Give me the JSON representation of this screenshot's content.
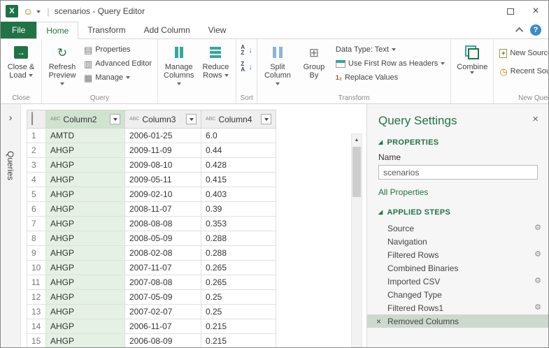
{
  "window": {
    "title": "scenarios - Query Editor",
    "title_separator": "|",
    "excel_logo": "X"
  },
  "icons": {
    "smiley": "☺",
    "close_x": "×",
    "delete_x": "×",
    "gear": "⚙",
    "help": "?",
    "refresh": "↻",
    "sheet": "▤",
    "adv_editor": "▥",
    "manage": "▦",
    "group_by": "⊞",
    "arrow_right": "→",
    "sort_arrow": "↓",
    "replace": "1₂",
    "clock": "◷",
    "plus": "+",
    "triangle": "◢",
    "chevron_right": "›",
    "scroll_up": "▲",
    "type_abc": "ABC"
  },
  "ribbon": {
    "tabs": [
      "File",
      "Home",
      "Transform",
      "Add Column",
      "View"
    ],
    "active_tab": "Home",
    "groups": {
      "close": {
        "label": "Close",
        "close_load": [
          "Close &",
          "Load"
        ]
      },
      "query": {
        "label": "Query",
        "refresh": [
          "Refresh",
          "Preview"
        ],
        "properties": "Properties",
        "advanced_editor": "Advanced Editor",
        "manage": "Manage"
      },
      "columns": {
        "label": "",
        "manage_columns": [
          "Manage",
          "Columns"
        ],
        "reduce_rows": [
          "Reduce",
          "Rows"
        ]
      },
      "sort": {
        "label": "Sort",
        "asc": "AZ",
        "desc": "ZA"
      },
      "transform": {
        "label": "Transform",
        "split_column": [
          "Split",
          "Column"
        ],
        "group_by": [
          "Group",
          "By"
        ],
        "data_type": "Data Type: Text",
        "first_row": "Use First Row as Headers",
        "replace_values": "Replace Values"
      },
      "combine": {
        "label": "",
        "combine": "Combine"
      },
      "new_query": {
        "label": "New Query",
        "new_source": "New Source",
        "recent_sources": "Recent Sources"
      }
    }
  },
  "sidebar": {
    "label": "Queries"
  },
  "grid": {
    "columns": [
      {
        "name": "Column2",
        "type": "ABC",
        "selected": true
      },
      {
        "name": "Column3",
        "type": "ABC",
        "selected": false
      },
      {
        "name": "Column4",
        "type": "ABC",
        "selected": false
      }
    ],
    "rows": [
      {
        "num": 1,
        "cells": [
          "AMTD",
          "2006-01-25",
          "6.0"
        ]
      },
      {
        "num": 2,
        "cells": [
          "AHGP",
          "2009-11-09",
          "0.44"
        ]
      },
      {
        "num": 3,
        "cells": [
          "AHGP",
          "2009-08-10",
          "0.428"
        ]
      },
      {
        "num": 4,
        "cells": [
          "AHGP",
          "2009-05-11",
          "0.415"
        ]
      },
      {
        "num": 5,
        "cells": [
          "AHGP",
          "2009-02-10",
          "0.403"
        ]
      },
      {
        "num": 6,
        "cells": [
          "AHGP",
          "2008-11-07",
          "0.39"
        ]
      },
      {
        "num": 7,
        "cells": [
          "AHGP",
          "2008-08-08",
          "0.353"
        ]
      },
      {
        "num": 8,
        "cells": [
          "AHGP",
          "2008-05-09",
          "0.288"
        ]
      },
      {
        "num": 9,
        "cells": [
          "AHGP",
          "2008-02-08",
          "0.288"
        ]
      },
      {
        "num": 10,
        "cells": [
          "AHGP",
          "2007-11-07",
          "0.265"
        ]
      },
      {
        "num": 11,
        "cells": [
          "AHGP",
          "2007-08-08",
          "0.265"
        ]
      },
      {
        "num": 12,
        "cells": [
          "AHGP",
          "2007-05-09",
          "0.25"
        ]
      },
      {
        "num": 13,
        "cells": [
          "AHGP",
          "2007-02-07",
          "0.25"
        ]
      },
      {
        "num": 14,
        "cells": [
          "AHGP",
          "2006-11-07",
          "0.215"
        ]
      },
      {
        "num": 15,
        "cells": [
          "AHGP",
          "2006-08-09",
          "0.215"
        ]
      }
    ]
  },
  "settings_panel": {
    "title": "Query Settings",
    "properties_header": "PROPERTIES",
    "name_label": "Name",
    "name_value": "scenarios",
    "all_properties": "All Properties",
    "applied_steps_header": "APPLIED STEPS",
    "steps": [
      {
        "label": "Source",
        "gear": true,
        "selected": false
      },
      {
        "label": "Navigation",
        "gear": false,
        "selected": false
      },
      {
        "label": "Filtered Rows",
        "gear": true,
        "selected": false
      },
      {
        "label": "Combined Binaries",
        "gear": false,
        "selected": false
      },
      {
        "label": "Imported CSV",
        "gear": true,
        "selected": false
      },
      {
        "label": "Changed Type",
        "gear": false,
        "selected": false
      },
      {
        "label": "Filtered Rows1",
        "gear": true,
        "selected": false
      },
      {
        "label": "Removed Columns",
        "gear": false,
        "selected": true
      }
    ]
  },
  "colors": {
    "accent": "#217346",
    "selected_step_bg": "#ccd9cc",
    "selected_column_bg": "#e4f1e4",
    "help_blue": "#3b8bc4"
  }
}
